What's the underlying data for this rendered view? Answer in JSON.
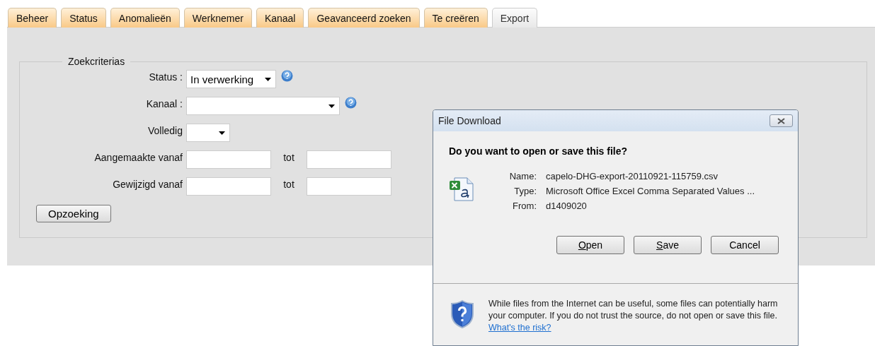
{
  "tabs": [
    {
      "label": "Beheer",
      "selected": false
    },
    {
      "label": "Status",
      "selected": false
    },
    {
      "label": "Anomalieën",
      "selected": false
    },
    {
      "label": "Werknemer",
      "selected": false
    },
    {
      "label": "Kanaal",
      "selected": false
    },
    {
      "label": "Geavanceerd zoeken",
      "selected": false
    },
    {
      "label": "Te creëren",
      "selected": false
    },
    {
      "label": "Export",
      "selected": true
    }
  ],
  "search_criteria": {
    "legend": "Zoekcriterias",
    "fields": [
      {
        "kind": "select",
        "label": "Status :",
        "value": "In verwerking",
        "help": true
      },
      {
        "kind": "select",
        "label": "Kanaal :",
        "help": true
      },
      {
        "kind": "select",
        "label": "Volledig",
        "help": false
      },
      {
        "kind": "range",
        "label": "Aangemaakte vanaf",
        "separator": "tot"
      },
      {
        "kind": "range",
        "label": "Gewijzigd vanaf",
        "separator": "tot"
      }
    ],
    "button": "Opzoeking"
  },
  "dialog": {
    "title": "File Download",
    "question": "Do you want to open or save this file?",
    "details": [
      {
        "label": "Name:",
        "value": "capelo-DHG-export-20110921-115759.csv"
      },
      {
        "label": "Type:",
        "value": "Microsoft Office Excel Comma Separated Values ..."
      },
      {
        "label": "From:",
        "value": "d1409020"
      }
    ],
    "buttons": [
      {
        "label": "Open",
        "mnemonic": true
      },
      {
        "label": "Save",
        "mnemonic": true
      },
      {
        "label": "Cancel",
        "mnemonic": false
      }
    ],
    "warning": "While files from the Internet can be useful, some files can potentially harm your computer. If you do not trust the source, do not open or save this file.",
    "link": "What's the risk?"
  }
}
